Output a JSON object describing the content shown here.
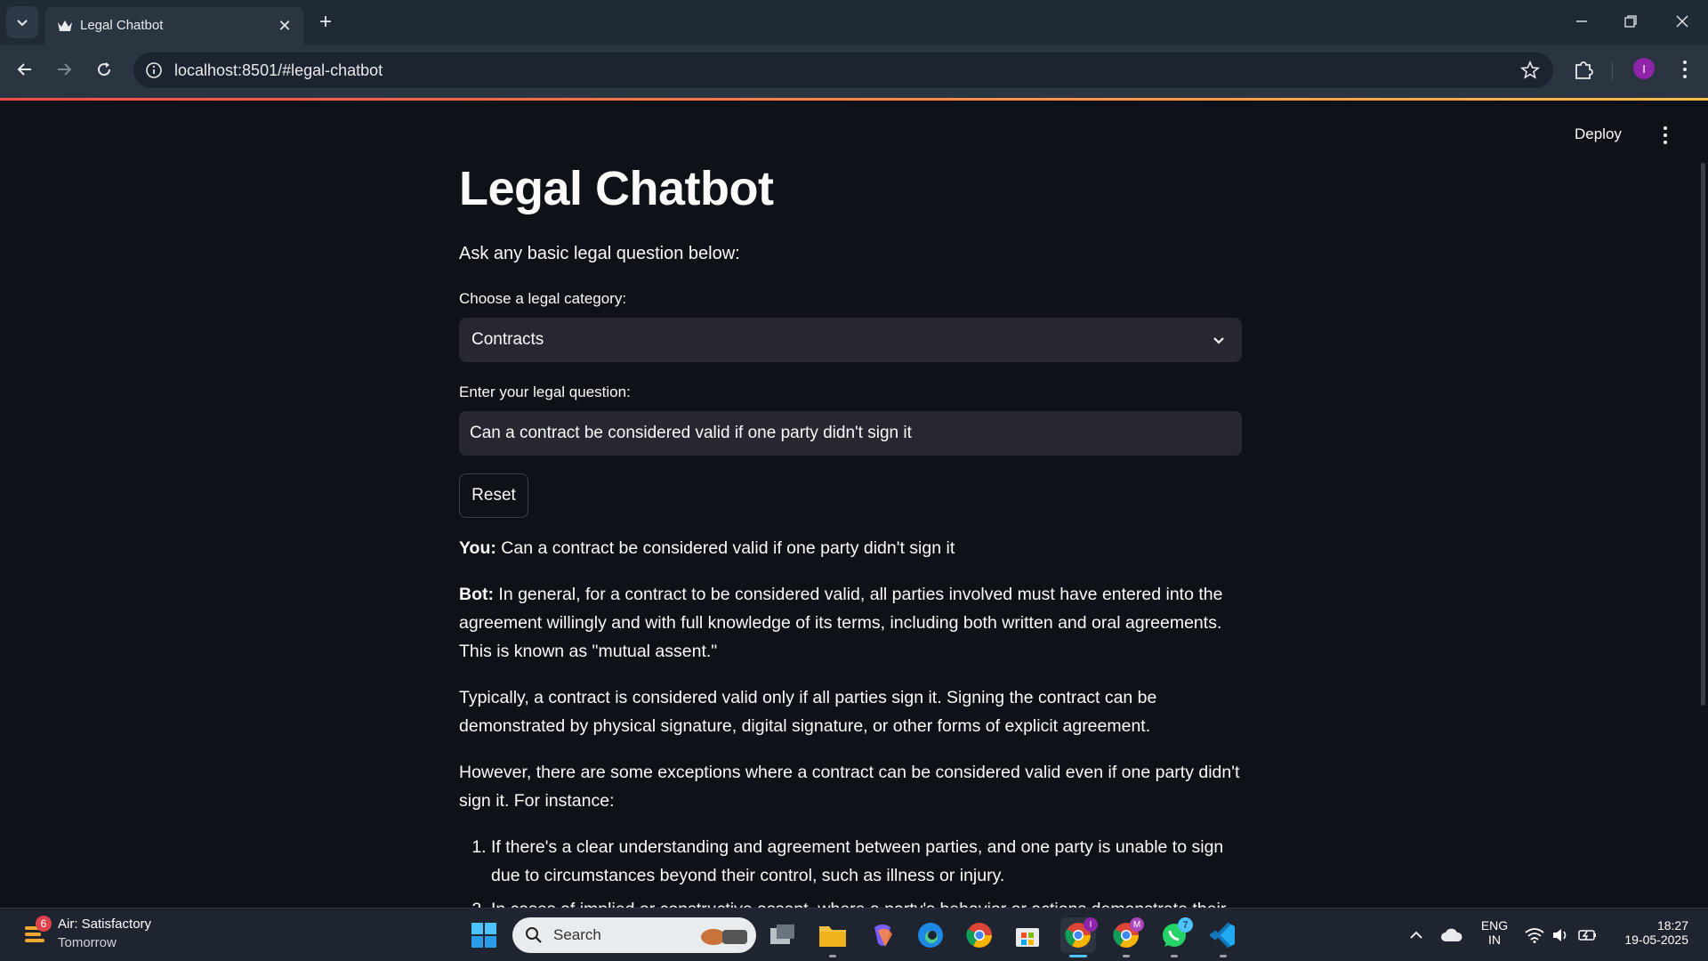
{
  "browser": {
    "tab_title": "Legal Chatbot",
    "url": "localhost:8501/#legal-chatbot",
    "profile_initial": "I"
  },
  "app": {
    "deploy_label": "Deploy",
    "title": "Legal Chatbot",
    "subtitle": "Ask any basic legal question below:",
    "category_label": "Choose a legal category:",
    "category_value": "Contracts",
    "question_label": "Enter your legal question:",
    "question_value": "Can a contract be considered valid if one party didn't sign it",
    "reset_label": "Reset"
  },
  "chat": {
    "you_label": "You:",
    "you_text": " Can a contract be considered valid if one party didn't sign it",
    "bot_label": "Bot:",
    "bot_p1": " In general, for a contract to be considered valid, all parties involved must have entered into the agreement willingly and with full knowledge of its terms, including both written and oral agreements. This is known as \"mutual assent.\"",
    "bot_p2": "Typically, a contract is considered valid only if all parties sign it. Signing the contract can be demonstrated by physical signature, digital signature, or other forms of explicit agreement.",
    "bot_p3": "However, there are some exceptions where a contract can be considered valid even if one party didn't sign it. For instance:",
    "list": [
      "If there's a clear understanding and agreement between parties, and one party is unable to sign due to circumstances beyond their control, such as illness or injury.",
      "In cases of implied or constructive assent, where a party's behavior or actions demonstrate their"
    ]
  },
  "taskbar": {
    "weather_badge": "6",
    "weather_title": "Air: Satisfactory",
    "weather_sub": "Tomorrow",
    "search_placeholder": "Search",
    "lang_1": "ENG",
    "lang_2": "IN",
    "time": "18:27",
    "date": "19-05-2025",
    "chrome_badge_1": "I",
    "chrome_badge_2": "M",
    "whatsapp_badge": "7"
  },
  "colors": {
    "accent": "#ff4b4b",
    "app_bg": "#0e1117",
    "widget_bg": "#262730"
  }
}
